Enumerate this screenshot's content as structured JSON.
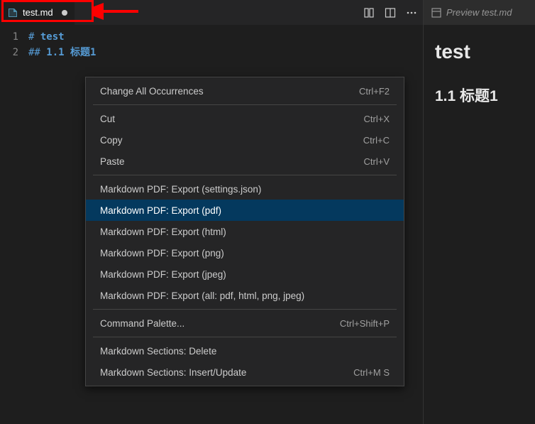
{
  "tab": {
    "filename": "test.md",
    "dirty": true
  },
  "editor": {
    "lines": [
      {
        "num": "1",
        "hash": "#",
        "text": "test"
      },
      {
        "num": "2",
        "hash": "##",
        "text": "1.1 标题1"
      }
    ]
  },
  "contextMenu": {
    "groups": [
      [
        {
          "label": "Change All Occurrences",
          "shortcut": "Ctrl+F2"
        }
      ],
      [
        {
          "label": "Cut",
          "shortcut": "Ctrl+X"
        },
        {
          "label": "Copy",
          "shortcut": "Ctrl+C"
        },
        {
          "label": "Paste",
          "shortcut": "Ctrl+V"
        }
      ],
      [
        {
          "label": "Markdown PDF: Export (settings.json)",
          "shortcut": ""
        },
        {
          "label": "Markdown PDF: Export (pdf)",
          "shortcut": "",
          "selected": true
        },
        {
          "label": "Markdown PDF: Export (html)",
          "shortcut": ""
        },
        {
          "label": "Markdown PDF: Export (png)",
          "shortcut": ""
        },
        {
          "label": "Markdown PDF: Export (jpeg)",
          "shortcut": ""
        },
        {
          "label": "Markdown PDF: Export (all: pdf, html, png, jpeg)",
          "shortcut": ""
        }
      ],
      [
        {
          "label": "Command Palette...",
          "shortcut": "Ctrl+Shift+P"
        }
      ],
      [
        {
          "label": "Markdown Sections: Delete",
          "shortcut": ""
        },
        {
          "label": "Markdown Sections: Insert/Update",
          "shortcut": "Ctrl+M S"
        }
      ]
    ]
  },
  "preview": {
    "tabLabel": "Preview test.md",
    "h1": "test",
    "h2": "1.1 标题1"
  }
}
